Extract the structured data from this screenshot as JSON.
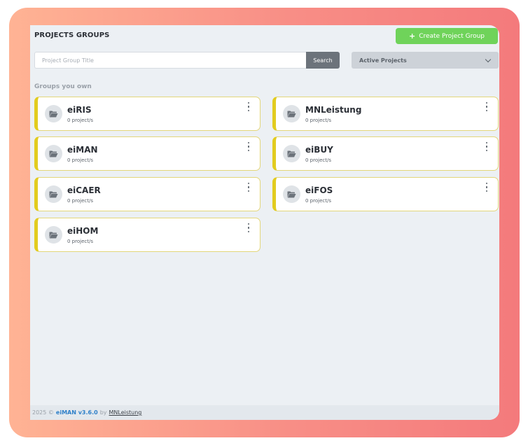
{
  "header": {
    "title": "PROJECTS GROUPS",
    "create_button_label": "Create Project Group",
    "create_button_icon": "+"
  },
  "search": {
    "placeholder": "Project Group Title",
    "value": "",
    "button_label": "Search"
  },
  "filter": {
    "selected": "Active Projects"
  },
  "section_label": "Groups you own",
  "groups": [
    {
      "name": "eiRIS",
      "count": "0 project/s"
    },
    {
      "name": "MNLeistung",
      "count": "0 project/s"
    },
    {
      "name": "eiMAN",
      "count": "0 project/s"
    },
    {
      "name": "eiBUY",
      "count": "0 project/s"
    },
    {
      "name": "eiCAER",
      "count": "0 project/s"
    },
    {
      "name": "eiFOS",
      "count": "0 project/s"
    },
    {
      "name": "eiHOM",
      "count": "0 project/s"
    }
  ],
  "footer": {
    "prefix": "2025 ©",
    "app": "eiMAN v3.6.0",
    "by": "by",
    "company": "MNLeistung"
  },
  "colors": {
    "accent_green": "#6fd35a",
    "card_border_accent": "#e2cc1f",
    "brand_blue": "#2f80c9",
    "frame_gradient_start": "#ffb394",
    "frame_gradient_end": "#f47a7c"
  },
  "icons": {
    "group": "folder-open-icon",
    "menu": "kebab-menu-icon",
    "dropdown": "chevron-down-icon"
  }
}
